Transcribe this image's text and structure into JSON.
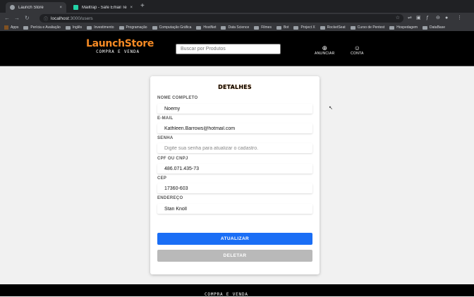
{
  "browser": {
    "tabs": [
      {
        "title": "Launch Store",
        "active": true,
        "favicon_color": "#9aa0a6"
      },
      {
        "title": "Mailtrap - Safe Email Testing",
        "active": false,
        "favicon_color": "#22d3a6"
      }
    ],
    "new_tab": "+",
    "close": "×",
    "nav": {
      "back": "←",
      "forward": "→",
      "reload": "↻"
    },
    "url": {
      "lock": "ⓘ",
      "host": "localhost",
      "path": ":3000/users",
      "star": "☆"
    },
    "extensions": [
      "⇌",
      "▣",
      "ƒ",
      "⊖",
      "●",
      "⋮"
    ],
    "bookmarks": [
      {
        "label": "Apps",
        "icon": "apps-icon"
      },
      {
        "label": "Perícia e Avaliação",
        "icon": "folder-icon"
      },
      {
        "label": "Inglês",
        "icon": "folder-icon"
      },
      {
        "label": "Investimento",
        "icon": "folder-icon"
      },
      {
        "label": "Programação",
        "icon": "folder-icon"
      },
      {
        "label": "Computação Gráfica",
        "icon": "folder-icon"
      },
      {
        "label": "HostNet",
        "icon": "folder-icon"
      },
      {
        "label": "Data Science",
        "icon": "folder-icon"
      },
      {
        "label": "Filmes",
        "icon": "folder-icon"
      },
      {
        "label": "Bot",
        "icon": "folder-icon"
      },
      {
        "label": "Project X",
        "icon": "folder-icon"
      },
      {
        "label": "RocketSeat",
        "icon": "folder-icon"
      },
      {
        "label": "Curso de Pentest",
        "icon": "folder-icon"
      },
      {
        "label": "Hospedagem",
        "icon": "folder-icon"
      },
      {
        "label": "DataBase",
        "icon": "folder-icon"
      }
    ]
  },
  "header": {
    "brand": "LaunchStore",
    "tagline": "COMPRA E VENDA",
    "search_placeholder": "Buscar por Produtos",
    "links": [
      {
        "icon": "⊕",
        "label": "ANUNCIAR"
      },
      {
        "icon": "☺",
        "label": "CONTA"
      }
    ],
    "brand_color": "#f58a24"
  },
  "form": {
    "title": "DETALHES",
    "fields": [
      {
        "label": "NOME COMPLETO",
        "value": "Noemy",
        "placeholder": ""
      },
      {
        "label": "E-MAIL",
        "value": "Kathleen.Barrows@hotmail.com",
        "placeholder": ""
      },
      {
        "label": "SENHA",
        "value": "",
        "placeholder": "Digite sua senha para atualizar o cadastro."
      },
      {
        "label": "CPF OU CNPJ",
        "value": "486.071.435-73",
        "placeholder": ""
      },
      {
        "label": "CEP",
        "value": "17360-603",
        "placeholder": ""
      },
      {
        "label": "ENDEREÇO",
        "value": "Stan Knoll",
        "placeholder": ""
      }
    ],
    "update_label": "ATUALIZAR",
    "delete_label": "DELETAR",
    "update_color": "#1a6ef5",
    "delete_color": "#b9b9b9"
  },
  "footer": {
    "brand": "COMPRA E VENDA"
  }
}
